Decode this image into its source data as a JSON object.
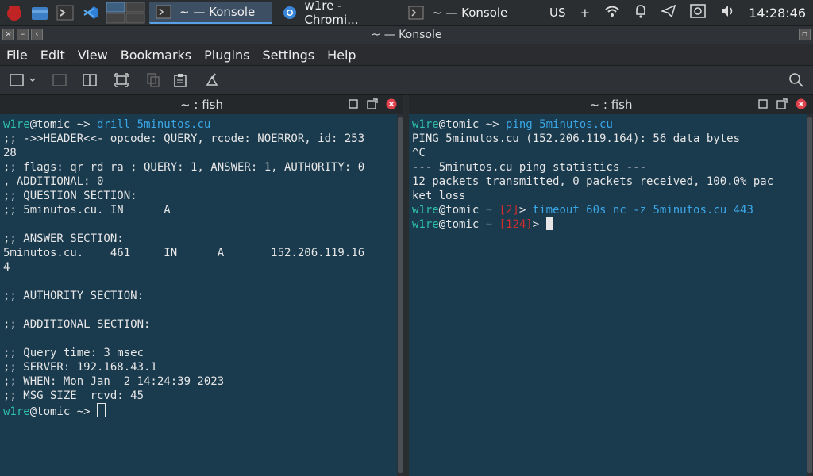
{
  "taskbar": {
    "tasks": [
      {
        "label": "~ — Konsole",
        "active": true
      },
      {
        "label": "w1re - Chromi...",
        "active": false
      },
      {
        "label": "~ — Konsole",
        "active": false
      }
    ],
    "keyboard": "US",
    "plus": "+",
    "clock": "14:28:46"
  },
  "window": {
    "title": "~ — Konsole"
  },
  "menu": [
    "File",
    "Edit",
    "View",
    "Bookmarks",
    "Plugins",
    "Settings",
    "Help"
  ],
  "left_pane": {
    "title": "~ : fish",
    "lines": [
      {
        "user": "w1re",
        "at": "@tomic",
        "prompt": " ~>",
        "cmd": " drill 5minutos.cu"
      },
      {
        "text": ";; ->>HEADER<<- opcode: QUERY, rcode: NOERROR, id: 253"
      },
      {
        "text": "28"
      },
      {
        "text": ";; flags: qr rd ra ; QUERY: 1, ANSWER: 1, AUTHORITY: 0"
      },
      {
        "text": ", ADDITIONAL: 0"
      },
      {
        "text": ";; QUESTION SECTION:"
      },
      {
        "text": ";; 5minutos.cu. IN      A"
      },
      {
        "text": ""
      },
      {
        "text": ";; ANSWER SECTION:"
      },
      {
        "text": "5minutos.cu.    461     IN      A       152.206.119.16"
      },
      {
        "text": "4"
      },
      {
        "text": ""
      },
      {
        "text": ";; AUTHORITY SECTION:"
      },
      {
        "text": ""
      },
      {
        "text": ";; ADDITIONAL SECTION:"
      },
      {
        "text": ""
      },
      {
        "text": ";; Query time: 3 msec"
      },
      {
        "text": ";; SERVER: 192.168.43.1"
      },
      {
        "text": ";; WHEN: Mon Jan  2 14:24:39 2023"
      },
      {
        "text": ";; MSG SIZE  rcvd: 45"
      },
      {
        "user": "w1re",
        "at": "@tomic",
        "prompt": " ~>",
        "cmd": " "
      }
    ]
  },
  "right_pane": {
    "title": "~ : fish",
    "lines": [
      {
        "user": "w1re",
        "at": "@tomic",
        "prompt": " ~>",
        "cmd": " ping 5minutos.cu"
      },
      {
        "text": "PING 5minutos.cu (152.206.119.164): 56 data bytes"
      },
      {
        "text": "^C"
      },
      {
        "text": "--- 5minutos.cu ping statistics ---"
      },
      {
        "text": "12 packets transmitted, 0 packets received, 100.0% pac"
      },
      {
        "text": "ket loss"
      },
      {
        "user": "w1re",
        "at": "@tomic",
        "prompt": " ~",
        "status": " [2]",
        "gt": ">",
        "cmd": " timeout 60s nc -z 5minutos.cu 443"
      },
      {
        "user": "w1re",
        "at": "@tomic",
        "prompt": " ~",
        "status": " [124]",
        "gt": ">",
        "cmd": " "
      }
    ]
  },
  "colors": {
    "user": "#2fbfa8",
    "command": "#3ba7e6",
    "error": "#d02c2c",
    "bg": "#1a3a4e"
  }
}
